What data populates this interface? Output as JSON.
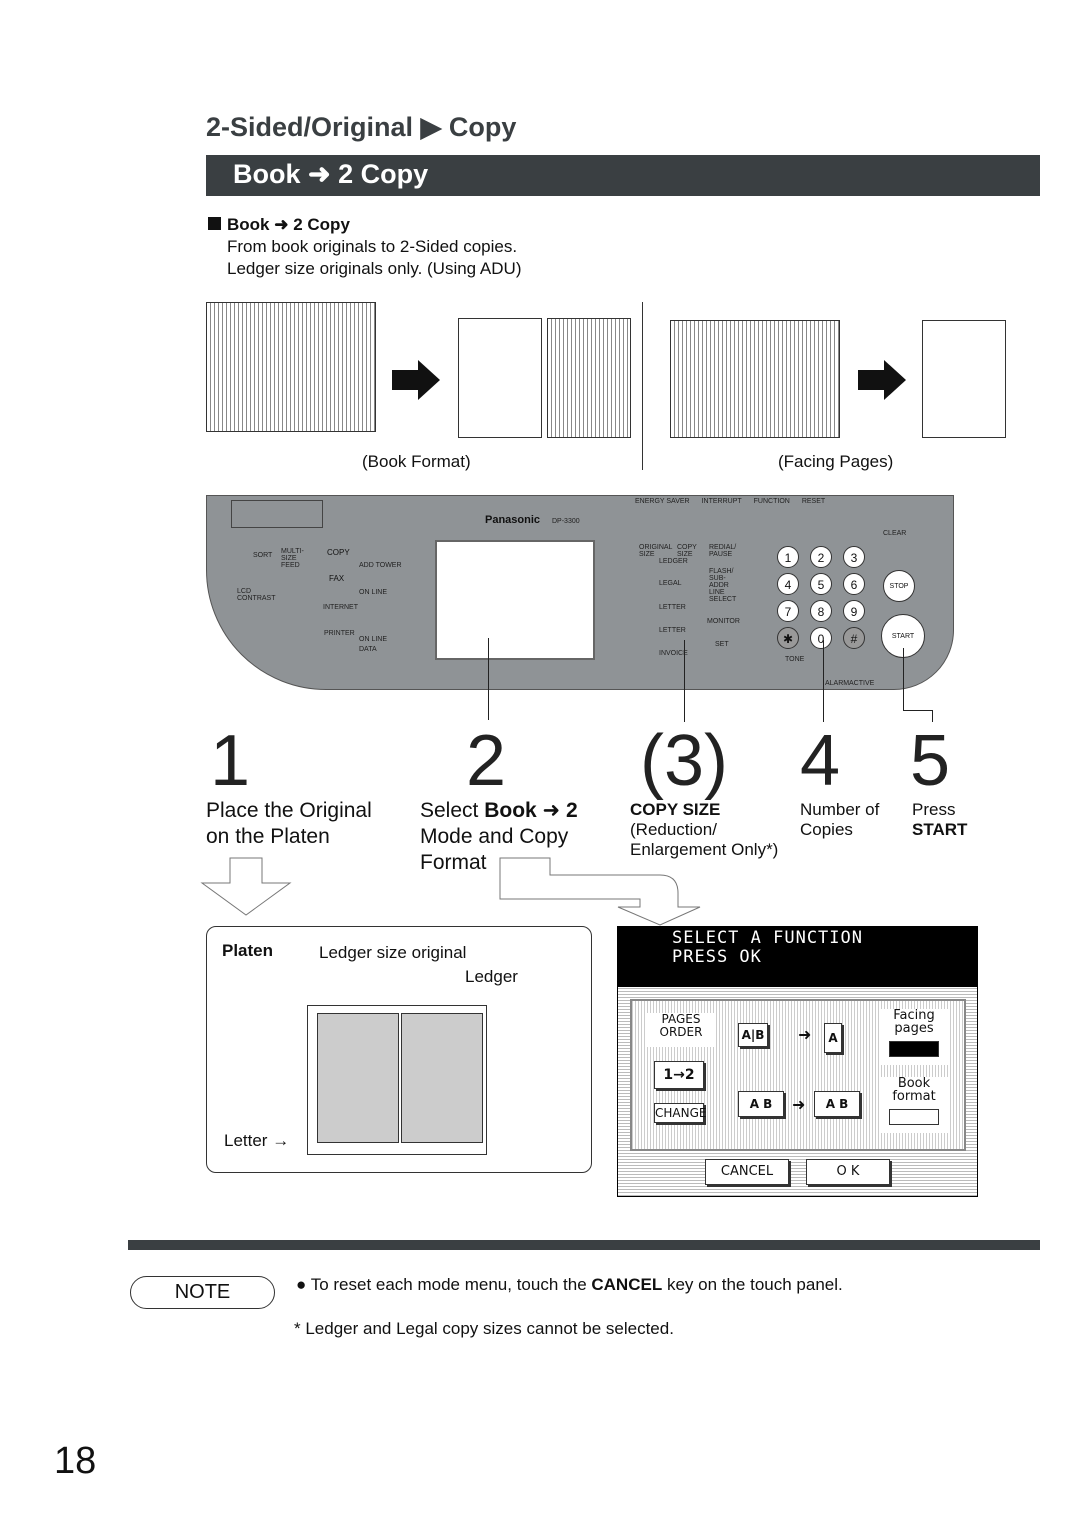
{
  "header": {
    "title_part1": "2-Sided/Original",
    "title_part2": "Copy",
    "banner_book": "Book",
    "banner_copy": "2 Copy"
  },
  "intro": {
    "heading_book": "Book",
    "heading_copy": "2 Copy",
    "line1": "From book originals to 2-Sided copies.",
    "line2": "Ledger size originals only. (Using ADU)"
  },
  "illustrations": {
    "left_caption": "(Book Format)",
    "right_caption": "(Facing Pages)"
  },
  "panel": {
    "brand": "Panasonic",
    "model": "DP-3300",
    "top_buttons": [
      "ENERGY SAVER",
      "INTERRUPT",
      "FUNCTION",
      "RESET"
    ],
    "left_labels": {
      "sort": "SORT",
      "multi": "MULTI-SIZE FEED",
      "lcd": "LCD CONTRAST",
      "copy": "COPY",
      "fax": "FAX",
      "internet": "INTERNET",
      "printer": "PRINTER",
      "adu": "ADD TOWER",
      "online1": "ON LINE",
      "online2": "ON LINE",
      "data": "DATA"
    },
    "size_labels": {
      "original": "ORIGINAL SIZE",
      "copy": "COPY SIZE",
      "ledger": "LEDGER",
      "legal": "LEGAL",
      "letter1": "LETTER",
      "letter2": "LETTER",
      "invoice": "INVOICE",
      "redial": "REDIAL/ PAUSE",
      "flash": "FLASH/ SUB-ADDR",
      "line": "LINE SELECT",
      "monitor": "MONITOR",
      "set": "SET"
    },
    "keys": [
      "1",
      "2",
      "3",
      "4",
      "5",
      "6",
      "7",
      "8",
      "9",
      "✱",
      "0",
      "#"
    ],
    "clear": "CLEAR",
    "stop": "STOP",
    "start": "START",
    "tone": "TONE",
    "alarm": "ALARM",
    "active": "ACTIVE"
  },
  "steps": [
    {
      "num": "1",
      "line1": "Place the Original",
      "line2": "on the Platen"
    },
    {
      "num": "2",
      "pre": "Select ",
      "bold": "Book",
      "bold2": "2",
      "line2": "Mode and Copy",
      "line3": "Format"
    },
    {
      "num": "(3)",
      "bold": "COPY SIZE",
      "line2": "(Reduction/",
      "line3": "Enlargement Only*)"
    },
    {
      "num": "4",
      "line1": "Number of",
      "line2": "Copies"
    },
    {
      "num": "5",
      "line1": "Press",
      "bold": "START"
    }
  ],
  "platen": {
    "title": "Platen",
    "original": "Ledger size original",
    "ledger": "Ledger",
    "letter": "Letter"
  },
  "lcd": {
    "line1": "SELECT A FUNCTION",
    "line2": "PRESS OK",
    "pages_order": "PAGES ORDER",
    "order_value": "1→2",
    "change": "CHANGE",
    "facing": "Facing pages",
    "book": "Book format",
    "cancel": "CANCEL",
    "ok": "O K",
    "facing_selected": true
  },
  "note": {
    "label": "NOTE",
    "pre": "To reset each mode menu, touch the ",
    "bold": "CANCEL",
    "post": " key on the touch panel.",
    "footnote": "*  Ledger and Legal copy sizes cannot be selected."
  },
  "page_number": "18"
}
